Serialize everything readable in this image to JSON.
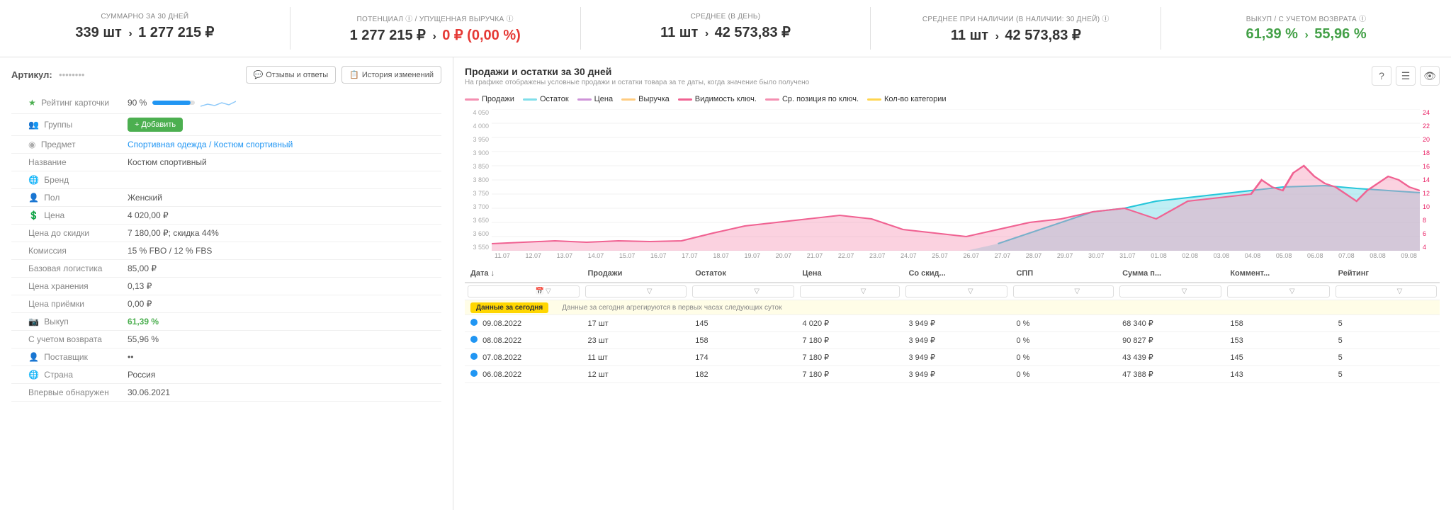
{
  "topStats": [
    {
      "id": "summary",
      "label": "СУММАРНО ЗА 30 ДНЕЙ",
      "value1": "339 шт",
      "arrow": "›",
      "value2": "1 277 215 ₽",
      "value2Color": "normal"
    },
    {
      "id": "potential",
      "label": "ПОТЕНЦИАЛ ⓘ / УПУЩЕННАЯ ВЫРУЧКА ⓘ",
      "value1": "1 277 215 ₽",
      "arrow": "›",
      "value2": "0 ₽ (0,00 %)",
      "value2Color": "red"
    },
    {
      "id": "average",
      "label": "СРЕДНЕЕ (В ДЕНЬ)",
      "value1": "11 шт",
      "arrow": "›",
      "value2": "42 573,83 ₽",
      "value2Color": "normal"
    },
    {
      "id": "average_stock",
      "label": "СРЕДНЕЕ ПРИ НАЛИЧИИ (В НАЛИЧИИ: 30 ДНЕЙ) ⓘ",
      "value1": "11 шт",
      "arrow": "›",
      "value2": "42 573,83 ₽",
      "value2Color": "normal"
    },
    {
      "id": "buyout",
      "label": "ВЫКУП / С УЧЕТОМ ВОЗВРАТА ⓘ",
      "value1": "61,39 %",
      "arrow": "›",
      "value2": "55,96 %",
      "value2Color": "green"
    }
  ],
  "article": {
    "label": "Артикул:",
    "id": "••••••••"
  },
  "buttons": {
    "reviews": "Отзывы и ответы",
    "history": "История изменений"
  },
  "properties": [
    {
      "icon": "star",
      "label": "Рейтинг карточки",
      "value": "90 %",
      "type": "rating"
    },
    {
      "icon": "group",
      "label": "Группы",
      "value": "",
      "type": "add"
    },
    {
      "icon": "category",
      "label": "Предмет",
      "value": "Спортивная одежда / Костюм спортивный",
      "type": "link"
    },
    {
      "icon": "",
      "label": "Название",
      "value": "Костюм спортивный",
      "type": "text"
    },
    {
      "icon": "globe",
      "label": "Бренд",
      "value": "",
      "type": "text"
    },
    {
      "icon": "person",
      "label": "Пол",
      "value": "Женский",
      "type": "text"
    },
    {
      "icon": "price",
      "label": "Цена",
      "value": "4 020,00 ₽",
      "type": "text"
    },
    {
      "icon": "",
      "label": "Цена до скидки",
      "value": "7 180,00 ₽; скидка 44%",
      "type": "text"
    },
    {
      "icon": "",
      "label": "Комиссия",
      "value": "15 % FBO / 12 % FBS",
      "type": "text"
    },
    {
      "icon": "",
      "label": "Базовая логистика",
      "value": "85,00 ₽",
      "type": "text"
    },
    {
      "icon": "",
      "label": "Цена хранения",
      "value": "0,13 ₽",
      "type": "text"
    },
    {
      "icon": "",
      "label": "Цена приёмки",
      "value": "0,00 ₽",
      "type": "text"
    },
    {
      "icon": "camera",
      "label": "Выкуп",
      "value": "61,39 %",
      "type": "green"
    },
    {
      "icon": "",
      "label": "С учетом возврата",
      "value": "55,96 %",
      "type": "text"
    },
    {
      "icon": "person2",
      "label": "Поставщик",
      "value": "••",
      "type": "text"
    },
    {
      "icon": "globe2",
      "label": "Страна",
      "value": "Россия",
      "type": "text"
    },
    {
      "icon": "",
      "label": "Впервые обнаружен",
      "value": "30.06.2021",
      "type": "text"
    }
  ],
  "chart": {
    "title": "Продажи и остатки за 30 дней",
    "subtitle": "На графике отображены условные продажи и остатки товара за те даты, когда значение было получено",
    "legend": [
      {
        "label": "Продажи",
        "color": "#f48fb1"
      },
      {
        "label": "Остаток",
        "color": "#80deea"
      },
      {
        "label": "Цена",
        "color": "#ce93d8"
      },
      {
        "label": "Выручка",
        "color": "#ffcc80"
      },
      {
        "label": "Видимость ключ.",
        "color": "#f06292"
      },
      {
        "label": "Ср. позиция по ключ.",
        "color": "#f48fb1"
      },
      {
        "label": "Кол-во категории",
        "color": "#ffd54f"
      }
    ],
    "yAxisLeft": [
      "4 050",
      "4 000",
      "3 950",
      "3 900",
      "3 850",
      "3 800",
      "3 750",
      "3 700",
      "3 650",
      "3 600",
      "3 550"
    ],
    "yAxisRight": [
      "24",
      "22",
      "20",
      "18",
      "16",
      "14",
      "12",
      "10",
      "8",
      "6",
      "4"
    ],
    "xAxis": [
      "11.07",
      "12.07",
      "13.07",
      "14.07",
      "15.07",
      "16.07",
      "17.07",
      "18.07",
      "19.07",
      "20.07",
      "21.07",
      "22.07",
      "23.07",
      "24.07",
      "25.07",
      "26.07",
      "27.07",
      "28.07",
      "29.07",
      "30.07",
      "31.07",
      "01.08",
      "02.08",
      "03.08",
      "04.08",
      "05.08",
      "06.08",
      "07.08",
      "08.08",
      "09.08"
    ]
  },
  "table": {
    "todayBadge": "Данные за сегодня",
    "todayNote": "Данные за сегодня агрегируются в первых часах следующих суток",
    "columns": [
      "Дата ↓",
      "Продажи",
      "Остаток",
      "Цена",
      "Со скид...",
      "СПП",
      "Сумма п...",
      "Коммент...",
      "Рейтинг"
    ],
    "rows": [
      {
        "date": "09.08.2022",
        "sales": "17 шт",
        "stock": "145",
        "price": "4 020 ₽",
        "discount": "3 949 ₽",
        "spp": "0 %",
        "sum": "68 340 ₽",
        "comments": "158",
        "rating": "5"
      },
      {
        "date": "08.08.2022",
        "sales": "23 шт",
        "stock": "158",
        "price": "7 180 ₽",
        "discount": "3 949 ₽",
        "spp": "0 %",
        "sum": "90 827 ₽",
        "comments": "153",
        "rating": "5"
      },
      {
        "date": "07.08.2022",
        "sales": "11 шт",
        "stock": "174",
        "price": "7 180 ₽",
        "discount": "3 949 ₽",
        "spp": "0 %",
        "sum": "43 439 ₽",
        "comments": "145",
        "rating": "5"
      },
      {
        "date": "06.08.2022",
        "sales": "12 шт",
        "stock": "182",
        "price": "7 180 ₽",
        "discount": "3 949 ₽",
        "spp": "0 %",
        "sum": "47 388 ₽",
        "comments": "143",
        "rating": "5"
      }
    ]
  }
}
